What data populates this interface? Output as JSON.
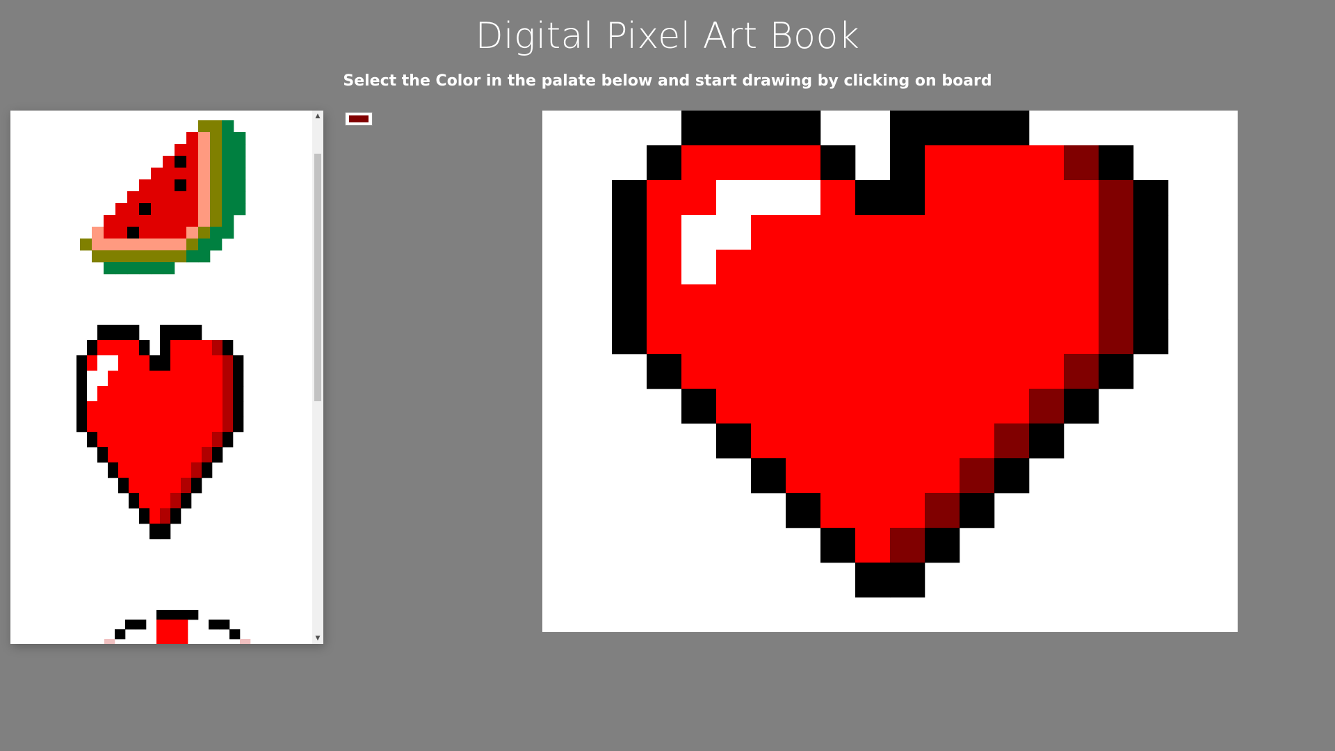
{
  "header": {
    "title": "Digital Pixel Art Book",
    "subtitle": "Select the Color in the palate below and start drawing by clicking on board"
  },
  "colors": {
    "background": "#808080",
    "selected": "#800000",
    "heart_red": "#ff0000",
    "heart_dark": "#800000",
    "outline": "#000000",
    "highlight": "#ffffff",
    "melon_red": "#e00000",
    "melon_rind_light": "#ff9a80",
    "melon_olive": "#808000",
    "melon_green": "#008040",
    "thumb_heart_dark": "#b00000"
  },
  "gallery": {
    "items": [
      {
        "name": "watermelon",
        "icon": "watermelon-pixel-art"
      },
      {
        "name": "heart",
        "icon": "heart-pixel-art"
      },
      {
        "name": "partial",
        "icon": "partial-pixel-art"
      }
    ],
    "scroll_up_icon": "▲",
    "scroll_down_icon": "▼"
  },
  "palette": {
    "selected_color": "#800000"
  },
  "board": {
    "artwork": "heart",
    "grid_cols": 20,
    "grid_rows": 15
  }
}
